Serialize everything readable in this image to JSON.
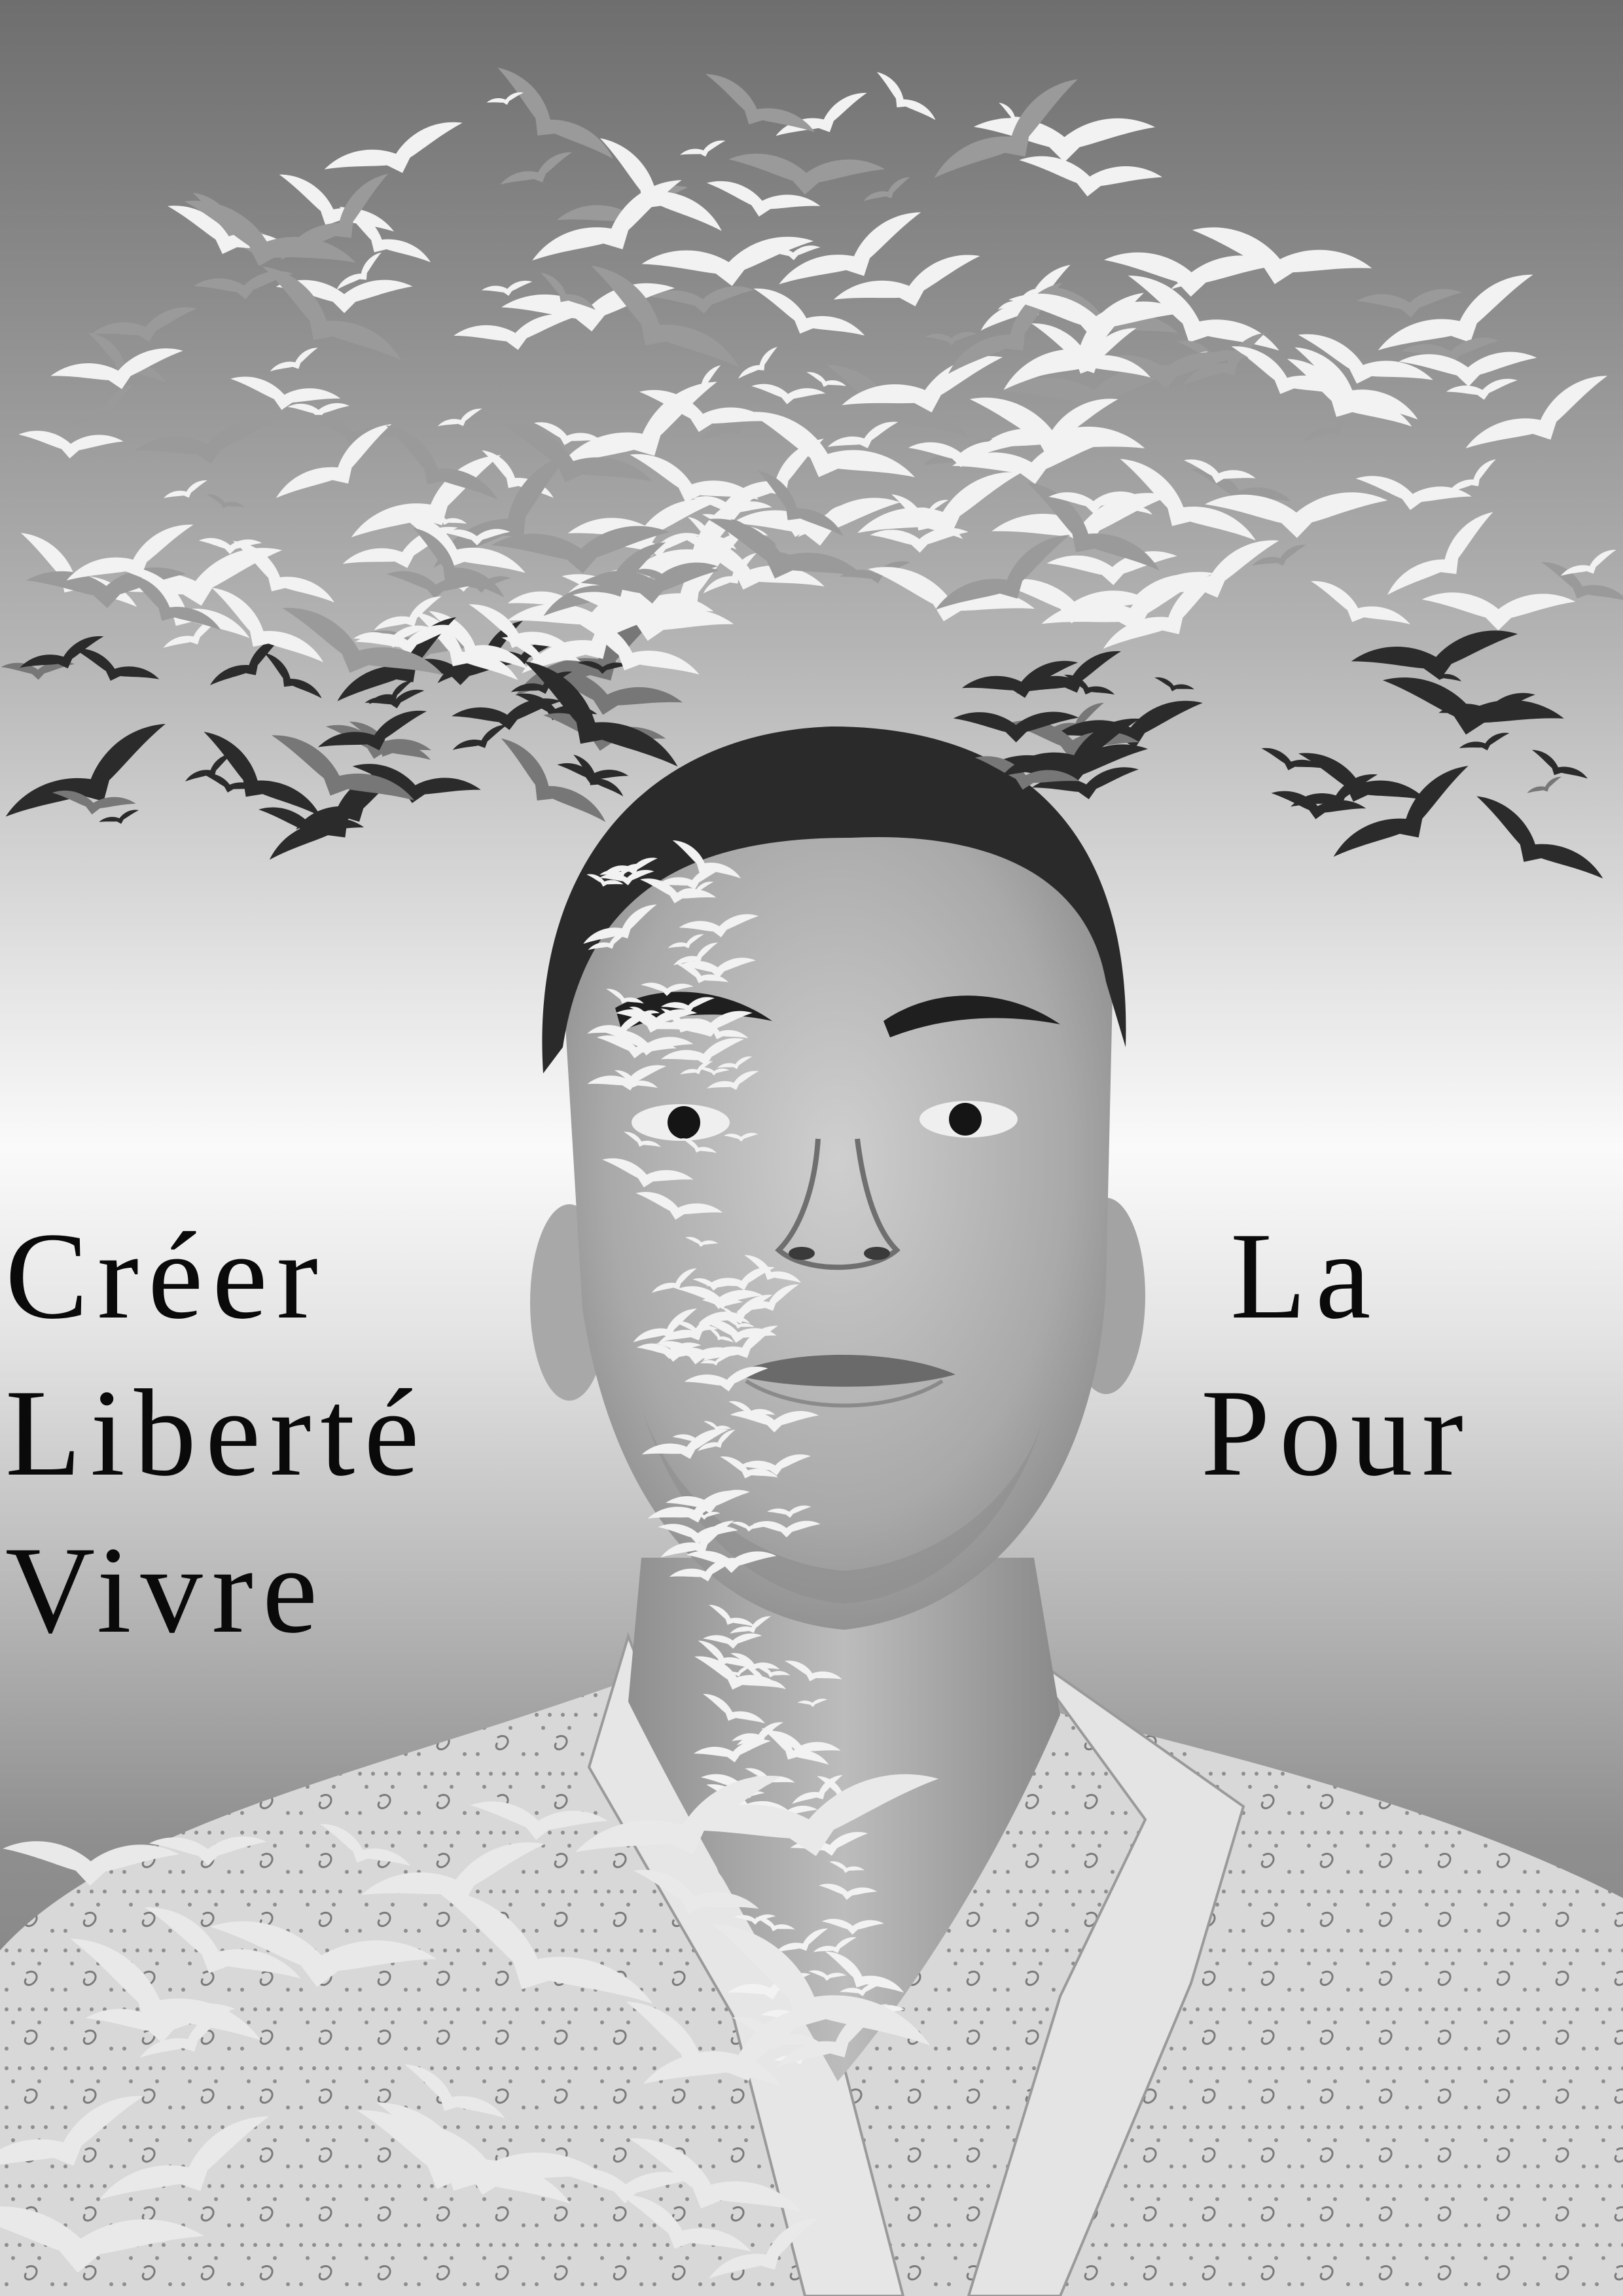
{
  "poster": {
    "left_words": [
      "Créer",
      "Liberté",
      "Vivre"
    ],
    "right_words": [
      "La",
      "Pour"
    ]
  },
  "colors": {
    "text": "#0a0a0a",
    "sky_top": "#6e6e6e",
    "sky_mid": "#fafafa",
    "skin": "#b9b9b9",
    "hair": "#2a2a2a",
    "shirt": "#d6d6d6",
    "bird_dark": "#2b2b2b",
    "bird_light": "#f2f2f2"
  },
  "icons": {
    "bird": "bird-icon"
  }
}
